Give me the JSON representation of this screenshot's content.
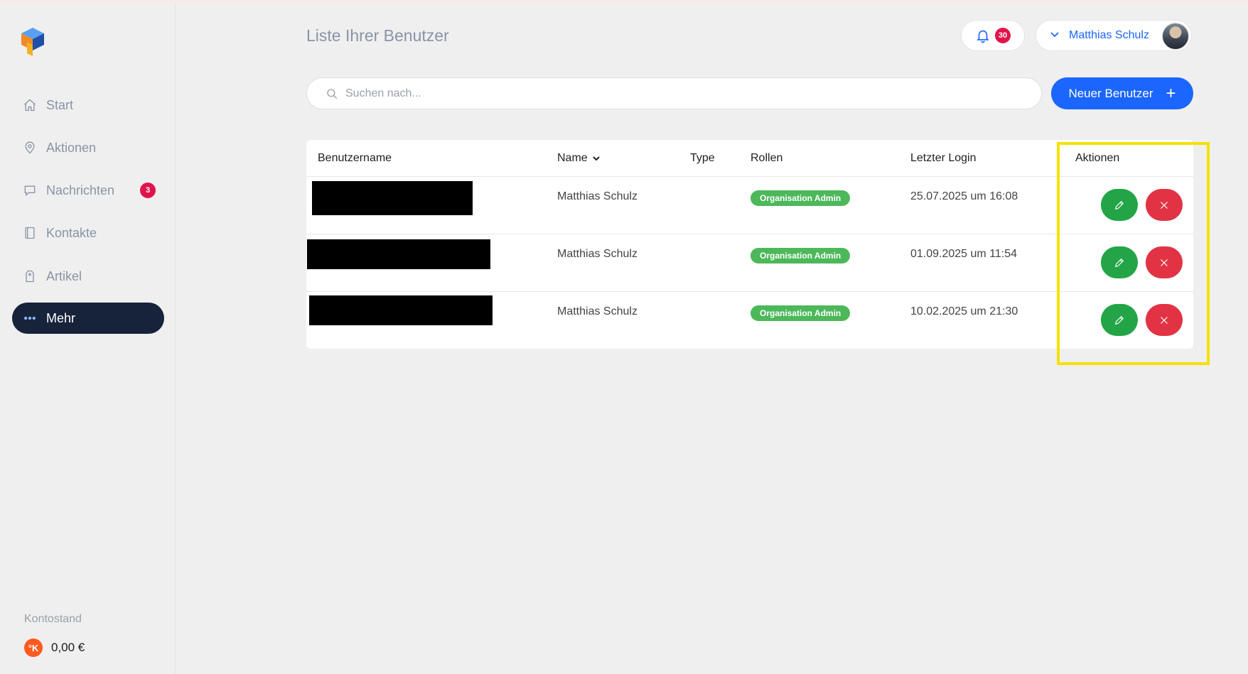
{
  "sidebar": {
    "items": [
      {
        "label": "Start",
        "icon": "home-icon"
      },
      {
        "label": "Aktionen",
        "icon": "location-icon"
      },
      {
        "label": "Nachrichten",
        "icon": "chat-icon",
        "badge": "3"
      },
      {
        "label": "Kontakte",
        "icon": "contacts-book-icon"
      },
      {
        "label": "Artikel",
        "icon": "tag-icon"
      },
      {
        "label": "Mehr",
        "icon": "more-dots-icon",
        "active": true
      }
    ],
    "balance_label": "Kontostand",
    "balance_coin": "°K",
    "balance_value": "0,00 €"
  },
  "header": {
    "title": "Liste Ihrer Benutzer",
    "notifications_count": "30",
    "user_name": "Matthias Schulz"
  },
  "search": {
    "placeholder": "Suchen nach..."
  },
  "new_user_button": {
    "label": "Neuer Benutzer",
    "plus": "+"
  },
  "table": {
    "columns": [
      "Benutzername",
      "Name",
      "Type",
      "Rollen",
      "Letzter Login",
      "Aktionen"
    ],
    "rows": [
      {
        "name": "Matthias Schulz",
        "type": "",
        "role": "Organisation Admin",
        "last_login": "25.07.2025 um 16:08"
      },
      {
        "name": "Matthias Schulz",
        "type": "",
        "role": "Organisation Admin",
        "last_login": "01.09.2025 um 11:54"
      },
      {
        "name": "Matthias Schulz",
        "type": "",
        "role": "Organisation Admin",
        "last_login": "10.02.2025 um 21:30"
      }
    ]
  },
  "colors": {
    "primary": "#1a66ff",
    "sidebar_active": "#16233a",
    "badge": "#e0144c",
    "edit": "#23a547",
    "delete": "#e23345",
    "role_badge": "#4cb85a",
    "highlight": "#f5e100"
  }
}
